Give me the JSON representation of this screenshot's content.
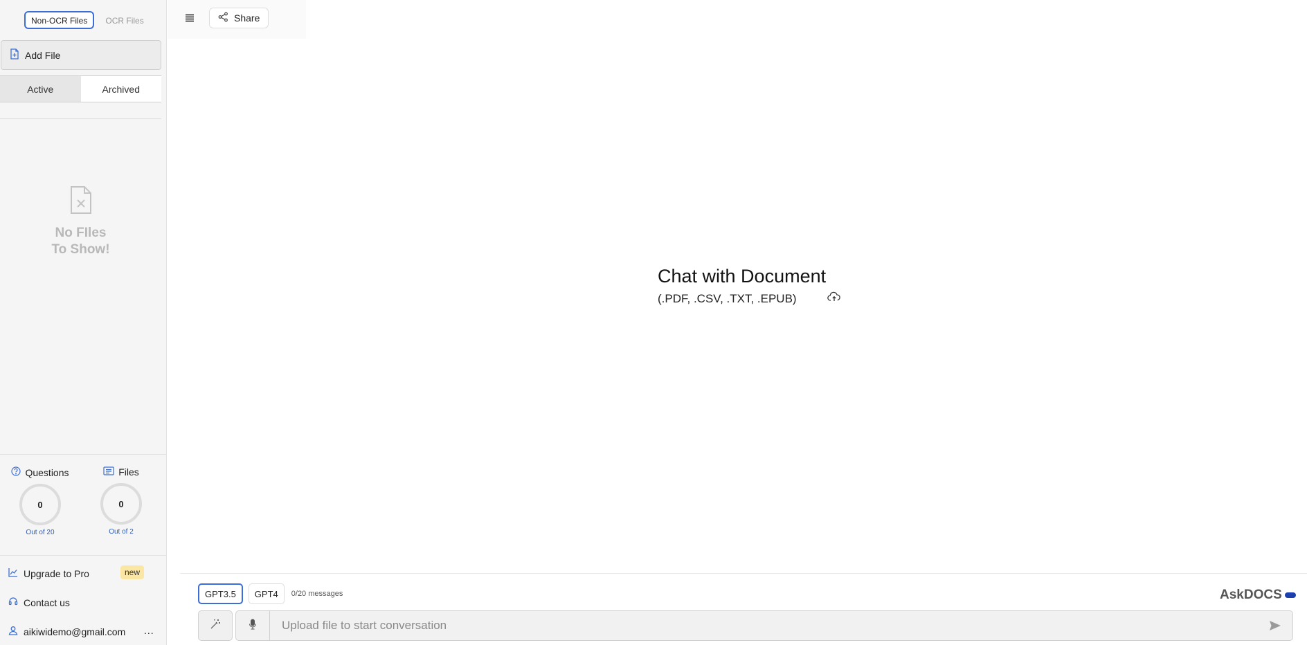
{
  "sidebar": {
    "file_types": {
      "non_ocr": "Non-OCR Files",
      "ocr": "OCR Files"
    },
    "add_file": "Add File",
    "tabs": {
      "active": "Active",
      "archived": "Archived"
    },
    "empty": {
      "line1": "No FIles",
      "line2": "To Show!"
    },
    "stats": {
      "questions": {
        "label": "Questions",
        "value": "0",
        "sub": "Out of 20"
      },
      "files": {
        "label": "Files",
        "value": "0",
        "sub": "Out of 2"
      }
    },
    "menu": {
      "upgrade": "Upgrade to Pro",
      "upgrade_badge": "new",
      "contact": "Contact us",
      "user_email": "aikiwidemo@gmail.com",
      "more": "..."
    }
  },
  "topbar": {
    "share": "Share"
  },
  "center": {
    "title": "Chat with Document",
    "subtitle": "(.PDF, .CSV, .TXT, .EPUB)"
  },
  "bottom": {
    "models": {
      "gpt35": "GPT3.5",
      "gpt4": "GPT4"
    },
    "message_count": "0/20 messages",
    "brand": "AskDOCS",
    "input_placeholder": "Upload file to start conversation"
  },
  "colors": {
    "accent": "#3b6fd6",
    "brand_pill": "#1e3fae",
    "badge": "#fbe7a3",
    "link": "#2e5db8"
  },
  "icons": [
    "add-file-icon",
    "no-files-icon",
    "question-icon",
    "files-icon",
    "chart-up-icon",
    "headset-icon",
    "user-icon",
    "hamburger-icon",
    "share-icon",
    "cloud-upload-icon",
    "magic-wand-icon",
    "microphone-icon",
    "send-icon"
  ]
}
